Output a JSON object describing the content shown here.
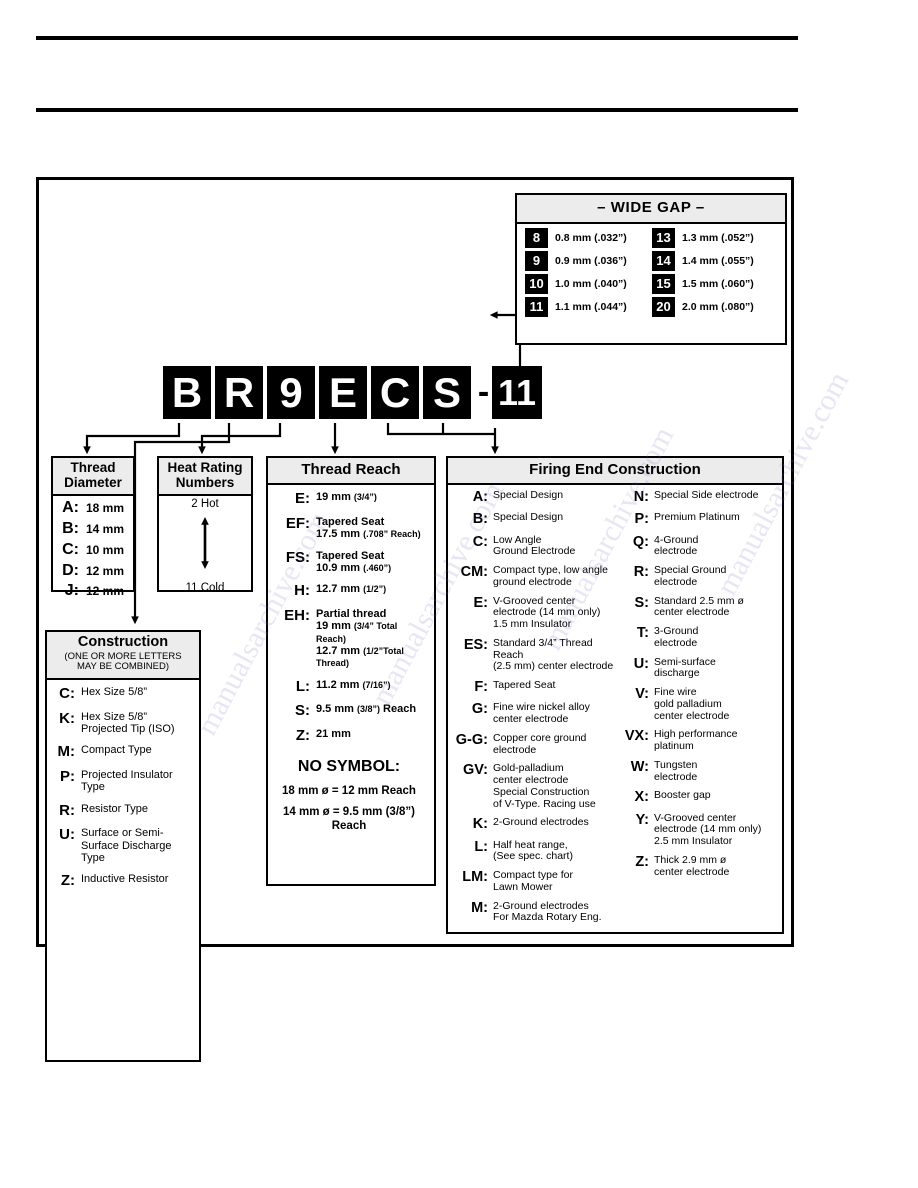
{
  "part_number": {
    "tiles": [
      "B",
      "R",
      "9",
      "E",
      "C",
      "S"
    ],
    "dash": "-",
    "gap_code": "11"
  },
  "wide_gap": {
    "title": "– WIDE GAP –",
    "entries": [
      {
        "code": "8",
        "text": "0.8 mm (.032”)"
      },
      {
        "code": "13",
        "text": "1.3 mm (.052”)"
      },
      {
        "code": "9",
        "text": "0.9 mm (.036”)"
      },
      {
        "code": "14",
        "text": "1.4 mm (.055”)"
      },
      {
        "code": "10",
        "text": "1.0 mm (.040”)"
      },
      {
        "code": "15",
        "text": "1.5 mm (.060”)"
      },
      {
        "code": "11",
        "text": "1.1 mm (.044”)"
      },
      {
        "code": "20",
        "text": "2.0 mm (.080”)"
      }
    ]
  },
  "thread_diameter": {
    "title_line1": "Thread",
    "title_line2": "Diameter",
    "rows": [
      {
        "code": "A:",
        "desc": "18 mm"
      },
      {
        "code": "B:",
        "desc": "14 mm"
      },
      {
        "code": "C:",
        "desc": "10 mm"
      },
      {
        "code": "D:",
        "desc": "12 mm"
      },
      {
        "code": "J:",
        "desc": "12 mm"
      }
    ]
  },
  "heat_rating": {
    "title_line1": "Heat Rating",
    "title_line2": "Numbers",
    "hot_label": "2 Hot",
    "cold_label": "11 Cold"
  },
  "thread_reach": {
    "title": "Thread Reach",
    "rows": [
      {
        "code": "E:",
        "desc": "19 mm <span class=\"sm\">(3/4”)</span>"
      },
      {
        "code": "EF:",
        "desc": "Tapered Seat<br>17.5 mm <span class=\"sm\">(.708” Reach)</span>"
      },
      {
        "code": "FS:",
        "desc": "Tapered Seat<br>10.9 mm <span class=\"sm\">(.460”)</span>"
      },
      {
        "code": "H:",
        "desc": "12.7 mm <span class=\"sm\">(1/2”)</span>"
      },
      {
        "code": "EH:",
        "desc": "Partial thread<br>19 mm <span class=\"sm\">(3/4” Total Reach)</span><br>12.7 mm <span class=\"sm\">(1/2”Total Thread)</span>"
      },
      {
        "code": "L:",
        "desc": "11.2 mm <span class=\"sm\">(7/16”)</span>"
      },
      {
        "code": "S:",
        "desc": "9.5 mm <span class=\"sm\">(3/8”)</span> Reach"
      },
      {
        "code": "Z:",
        "desc": "21 mm"
      }
    ],
    "no_symbol_title": "NO SYMBOL:",
    "no_symbol_lines": [
      "18 mm ø = 12 mm Reach",
      "14 mm ø = 9.5 mm (3/8”)<br>Reach"
    ]
  },
  "construction": {
    "title": "Construction",
    "subtitle": "(ONE OR MORE LETTERS<br>MAY BE COMBINED)",
    "rows": [
      {
        "code": "C:",
        "desc": "Hex Size 5/8”"
      },
      {
        "code": "K:",
        "desc": "Hex Size 5/8”<br>Projected Tip (ISO)"
      },
      {
        "code": "M:",
        "desc": "Compact Type"
      },
      {
        "code": "P:",
        "desc": "Projected Insulator<br>Type"
      },
      {
        "code": "R:",
        "desc": "Resistor Type"
      },
      {
        "code": "U:",
        "desc": "Surface or Semi-<br>Surface Discharge<br>Type"
      },
      {
        "code": "Z:",
        "desc": "Inductive Resistor"
      }
    ]
  },
  "firing_end": {
    "title": "Firing End Construction",
    "left_rows": [
      {
        "code": "A:",
        "desc": "Special Design"
      },
      {
        "code": "B:",
        "desc": "Special Design"
      },
      {
        "code": "C:",
        "desc": "Low Angle<br>Ground Electrode"
      },
      {
        "code": "CM:",
        "desc": "Compact type, low angle<br>ground electrode"
      },
      {
        "code": "E:",
        "desc": "V-Grooved center<br>electrode (14 mm only)<br>1.5 mm Insulator"
      },
      {
        "code": "ES:",
        "desc": "Standard 3/4” Thread Reach<br>(2.5 mm) center electrode"
      },
      {
        "code": "F:",
        "desc": "Tapered Seat"
      },
      {
        "code": "G:",
        "desc": "Fine wire nickel alloy<br>center electrode"
      },
      {
        "code": "G-G:",
        "desc": "Copper core ground<br>electrode"
      },
      {
        "code": "GV:",
        "desc": "Gold-palladium<br>center electrode<br>Special Construction<br>of V-Type. Racing use"
      },
      {
        "code": "K:",
        "desc": "2-Ground electrodes"
      },
      {
        "code": "L:",
        "desc": "Half heat range,<br>(See spec. chart)"
      },
      {
        "code": "LM:",
        "desc": "Compact type for<br>Lawn Mower"
      },
      {
        "code": "M:",
        "desc": "2-Ground electrodes<br>For Mazda Rotary Eng."
      }
    ],
    "right_rows": [
      {
        "code": "N:",
        "desc": "Special Side electrode"
      },
      {
        "code": "P:",
        "desc": "Premium Platinum"
      },
      {
        "code": "Q:",
        "desc": "4-Ground<br>electrode"
      },
      {
        "code": "R:",
        "desc": "Special Ground<br>electrode"
      },
      {
        "code": "S:",
        "desc": "Standard 2.5 mm ø<br>center electrode"
      },
      {
        "code": "T:",
        "desc": "3-Ground<br>electrode"
      },
      {
        "code": "U:",
        "desc": "Semi-surface<br>discharge"
      },
      {
        "code": "V:",
        "desc": "Fine wire<br>gold palladium<br>center electrode"
      },
      {
        "code": "VX:",
        "desc": "High performance<br>platinum"
      },
      {
        "code": "W:",
        "desc": "Tungsten<br>electrode"
      },
      {
        "code": "X:",
        "desc": "Booster gap"
      },
      {
        "code": "Y:",
        "desc": "V-Grooved center<br>electrode (14 mm only)<br>2.5 mm Insulator"
      },
      {
        "code": "Z:",
        "desc": "Thick 2.9 mm ø<br>center electrode"
      }
    ]
  },
  "watermark": {
    "lines": [
      "manualsarchive.com",
      "manualsarchive.com",
      "manualsarchive.com",
      "manualsarchive.com"
    ]
  }
}
